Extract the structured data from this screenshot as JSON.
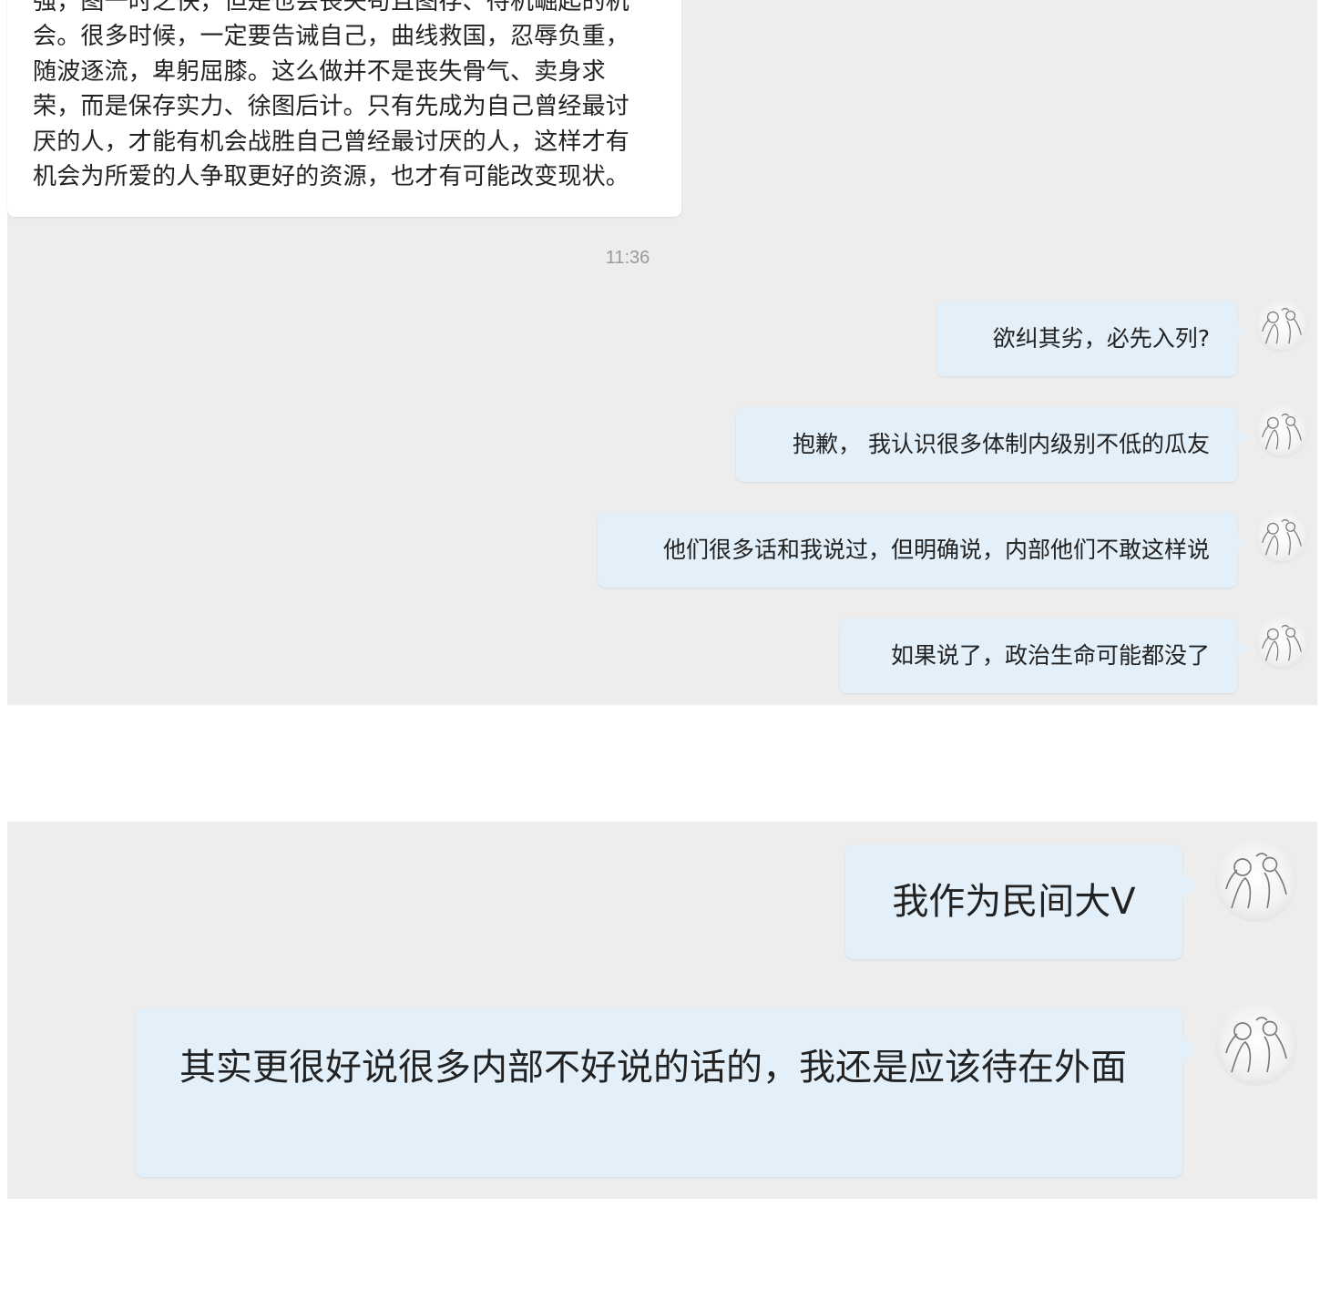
{
  "chat_top": {
    "incoming_message": "强，图一时之快，但是也会丧失苟且图存、待机崛起的机会。很多时候，一定要告诫自己，曲线救国，忍辱负重，随波逐流，卑躬屈膝。这么做并不是丧失骨气、卖身求荣，而是保存实力、徐图后计。只有先成为自己曾经最讨厌的人，才能有机会战胜自己曾经最讨厌的人，这样才有机会为所爱的人争取更好的资源，也才有可能改变现状。",
    "timestamp": "11:36",
    "outgoing": [
      {
        "text": "欲纠其劣，必先入列?",
        "avatar": "sketch-avatar"
      },
      {
        "text": "抱歉， 我认识很多体制内级别不低的瓜友",
        "avatar": "sketch-avatar"
      },
      {
        "text": "他们很多话和我说过，但明确说，内部他们不敢这样说",
        "avatar": "sketch-avatar"
      },
      {
        "text": "如果说了，政治生命可能都没了",
        "avatar": "sketch-avatar"
      }
    ]
  },
  "chat_bottom": {
    "outgoing": [
      {
        "text": "我作为民间大V",
        "avatar": "sketch-avatar"
      },
      {
        "text": "其实更很好说很多内部不好说的话的，我还是应该待在外面",
        "avatar": "sketch-avatar"
      }
    ]
  },
  "colors": {
    "chat_background": "#ededed",
    "incoming_bubble": "#ffffff",
    "outgoing_bubble": "#e3f0fa",
    "timestamp_text": "#9a9a9a"
  }
}
